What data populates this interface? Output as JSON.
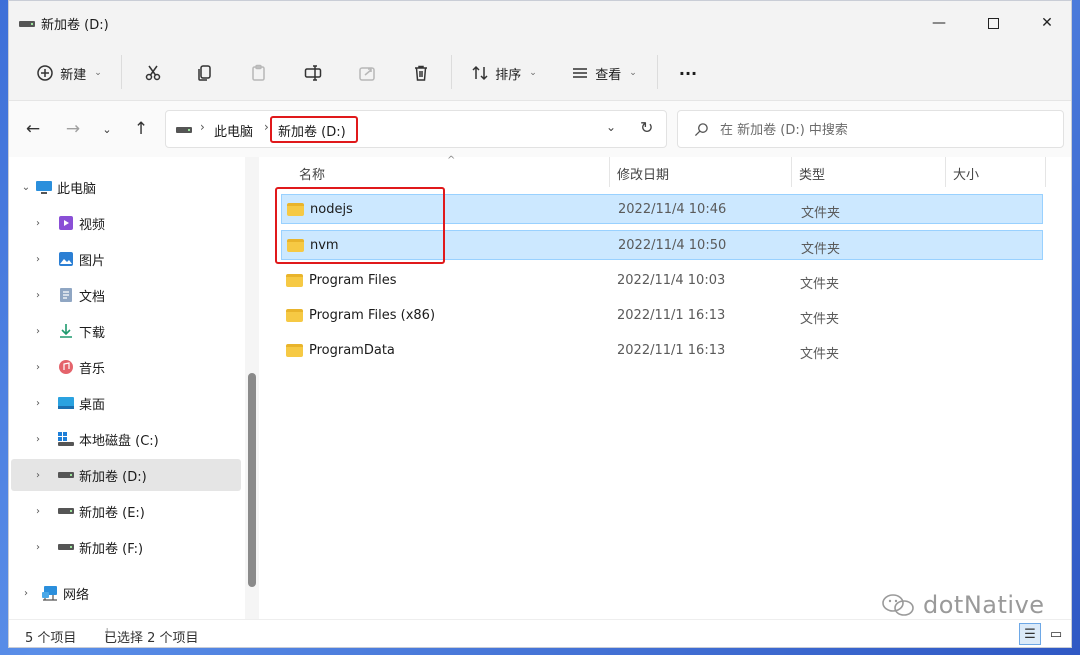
{
  "window": {
    "title": "新加卷 (D:)"
  },
  "toolbar": {
    "new_label": "新建",
    "sort_label": "排序",
    "view_label": "查看",
    "more_label": "···"
  },
  "address": {
    "crumbs": [
      "此电脑",
      "新加卷 (D:)"
    ],
    "search_placeholder": "在 新加卷 (D:) 中搜索"
  },
  "sidebar": {
    "items": [
      {
        "label": "此电脑",
        "icon": "monitor-icon"
      },
      {
        "label": "视频",
        "icon": "video-icon"
      },
      {
        "label": "图片",
        "icon": "picture-icon"
      },
      {
        "label": "文档",
        "icon": "document-icon"
      },
      {
        "label": "下载",
        "icon": "download-icon"
      },
      {
        "label": "音乐",
        "icon": "music-icon"
      },
      {
        "label": "桌面",
        "icon": "desktop-icon"
      },
      {
        "label": "本地磁盘 (C:)",
        "icon": "windows-drive-icon"
      },
      {
        "label": "新加卷 (D:)",
        "icon": "drive-icon",
        "selected": true
      },
      {
        "label": "新加卷 (E:)",
        "icon": "drive-icon"
      },
      {
        "label": "新加卷 (F:)",
        "icon": "drive-icon"
      },
      {
        "label": "网络",
        "icon": "network-icon"
      }
    ]
  },
  "columns": [
    "名称",
    "修改日期",
    "类型",
    "大小"
  ],
  "files": [
    {
      "name": "nodejs",
      "date": "2022/11/4 10:46",
      "type": "文件夹",
      "selected": true
    },
    {
      "name": "nvm",
      "date": "2022/11/4 10:50",
      "type": "文件夹",
      "selected": true
    },
    {
      "name": "Program Files",
      "date": "2022/11/4 10:03",
      "type": "文件夹"
    },
    {
      "name": "Program Files (x86)",
      "date": "2022/11/1 16:13",
      "type": "文件夹"
    },
    {
      "name": "ProgramData",
      "date": "2022/11/1 16:13",
      "type": "文件夹"
    }
  ],
  "status": {
    "count": "5 个项目",
    "selection": "已选择 2 个项目"
  },
  "watermark": "dotNative",
  "colors": {
    "accent_red": "#e0191b",
    "selection_bg": "#cce8ff",
    "folder": "#f6c944"
  }
}
